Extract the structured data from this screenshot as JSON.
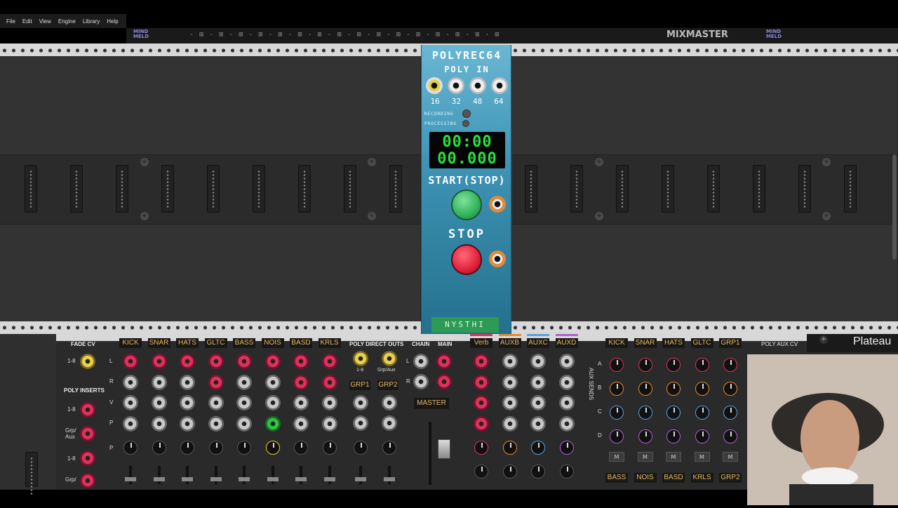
{
  "menu": [
    "File",
    "Edit",
    "View",
    "Engine",
    "Library",
    "Help"
  ],
  "top_modules": {
    "mixmaster": "MIXMASTER",
    "mindmeld_left": "MIND\nMELD",
    "mindmeld_right": "MIND\nMELD"
  },
  "polyrec": {
    "title": "POLYREC64",
    "poly_in": "POLY IN",
    "channels": [
      "16",
      "32",
      "48",
      "64"
    ],
    "recording": "RECORDING",
    "processing": "PROCESSING",
    "time_top": "00:00",
    "time_bottom": "00.000",
    "start_label": "START(STOP)",
    "stop_label": "STOP",
    "brand": "NYSTHI"
  },
  "mixer": {
    "fade_cv": "FADE CV",
    "fade_cv_sub": "1-8",
    "poly_inserts": "POLY INSERTS",
    "insert_labels": [
      "1-8",
      "Grp/\nAux",
      "1-8",
      "Grp/"
    ],
    "row_labels": [
      "L",
      "R",
      "V",
      "P",
      "P"
    ],
    "tracks": [
      "KICK",
      "SNAR",
      "HATS",
      "GLTC",
      "BASS",
      "NOIS",
      "BASD",
      "KRLS"
    ],
    "poly_direct_outs": "POLY DIRECT OUTS",
    "direct_sub": [
      "1-8",
      "Grp/Aux"
    ],
    "groups": [
      "GRP1",
      "GRP2"
    ],
    "chain": "CHAIN",
    "main": "MAIN",
    "master": "MASTER",
    "aux": [
      "Verb",
      "AUXB",
      "AUXC",
      "AUXD"
    ],
    "aux_sends_label": "AUX SENDS",
    "aux_rows": [
      "A",
      "B",
      "C",
      "D"
    ],
    "expander_tracks": [
      "KICK",
      "SNAR",
      "HATS",
      "GLTC",
      "GRP1"
    ],
    "expander_bottom": [
      "BASS",
      "NOIS",
      "BASD",
      "KRLS",
      "GRP2"
    ],
    "mute": "M",
    "poly_aux_cv": "POLY AUX CV",
    "lr": [
      "L",
      "R"
    ]
  },
  "plateau": "Plateau"
}
